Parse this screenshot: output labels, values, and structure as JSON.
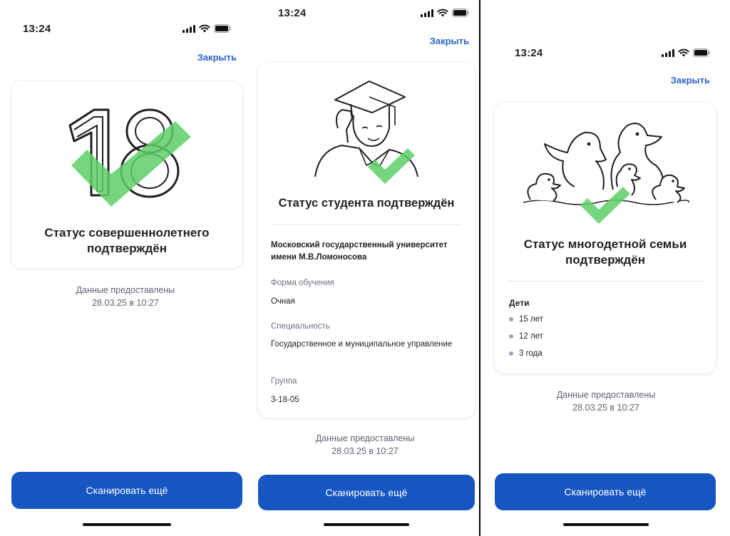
{
  "screens": [
    {
      "time": "13:24",
      "close_label": "Закрыть",
      "title": "Статус совершеннолетнего подтверждён",
      "provided_line1": "Данные предоставлены",
      "provided_line2": "28.03.25 в 10:27",
      "scan_label": "Сканировать ещё"
    },
    {
      "time": "13:24",
      "close_label": "Закрыть",
      "title": "Статус студента подтверждён",
      "university": "Московский государственный университет имени М.В.Ломоносова",
      "fields": [
        {
          "label": "Форма обучения",
          "value": "Очная"
        },
        {
          "label": "Специальность",
          "value": "Государственное и муниципальное управление"
        },
        {
          "label": "Группа",
          "value": "3-18-05"
        }
      ],
      "provided_line1": "Данные предоставлены",
      "provided_line2": "28.03.25 в 10:27",
      "scan_label": "Сканировать ещё"
    },
    {
      "time": "13:24",
      "close_label": "Закрыть",
      "title": "Статус многодетной семьи подтверждён",
      "children_title": "Дети",
      "children": [
        "15 лет",
        "12 лет",
        "3 года"
      ],
      "provided_line1": "Данные предоставлены",
      "provided_line2": "28.03.25 в 10:27",
      "scan_label": "Сканировать ещё"
    }
  ],
  "colors": {
    "accent": "#1656c1",
    "link": "#2a63c7",
    "check": "#5fd06a",
    "muted": "#5d6271"
  },
  "icons": {
    "signal": "cellular-signal-icon",
    "wifi": "wifi-icon",
    "battery": "battery-icon",
    "check": "checkmark-icon"
  },
  "illustrations": {
    "adult": "number-18-illustration",
    "student": "graduate-student-illustration",
    "family": "ducks-family-illustration"
  }
}
